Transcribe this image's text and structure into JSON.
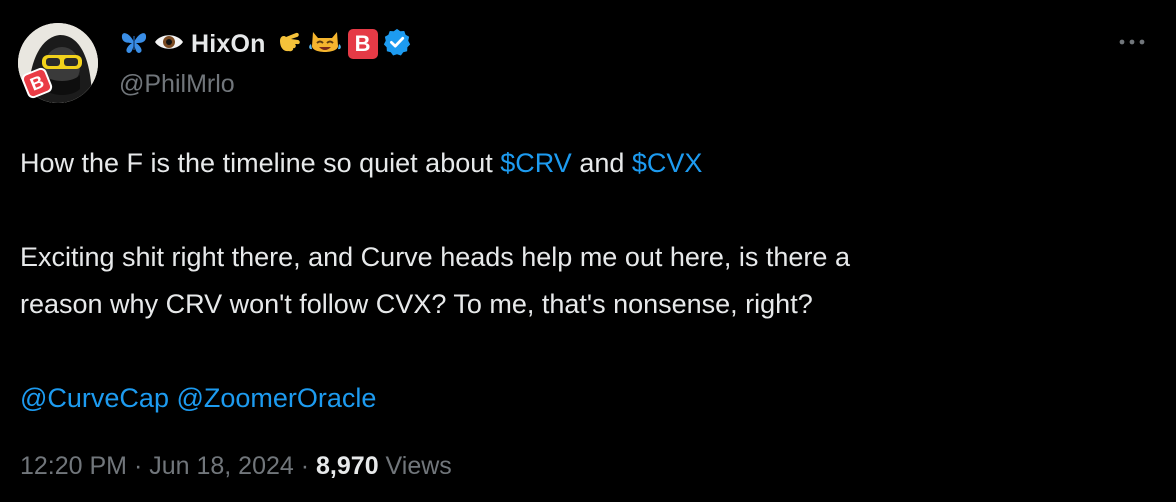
{
  "author": {
    "name_prefix_icons": [
      "butterfly-icon",
      "eye-icon"
    ],
    "display_name": "HixOn",
    "name_suffix_icons": [
      "pointing-hand-icon",
      "cat-laughing-icon"
    ],
    "badge_letter": "B",
    "handle": "@PhilMrlo",
    "avatar_badge_letter": "B"
  },
  "colors": {
    "background": "#000000",
    "text": "#e7e9ea",
    "muted": "#71767b",
    "link": "#1d9bf0",
    "badge_red": "#e53a46",
    "verified_blue": "#1d9bf0"
  },
  "tweet": {
    "line1": {
      "before": "How the F is the timeline so quiet about ",
      "cashtag1": "$CRV",
      "middle": " and ",
      "cashtag2": "$CVX"
    },
    "line2": "Exciting shit right there, and Curve heads help me out here, is there a",
    "line3": "reason why CRV won't follow CVX? To me, that's nonsense, right?",
    "mention1": "@CurveCap",
    "mention2": "@ZoomerOracle"
  },
  "meta": {
    "time": "12:20 PM",
    "separator": " · ",
    "date": "Jun 18, 2024",
    "views_count": "8,970",
    "views_label": " Views"
  }
}
